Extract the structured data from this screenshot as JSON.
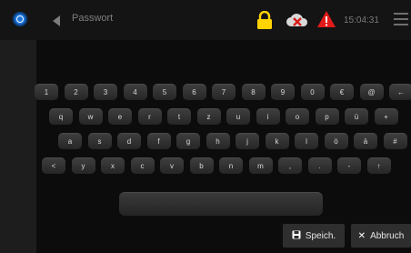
{
  "header": {
    "title": "Passwort",
    "time": "15:04:31",
    "lock_color": "#ffd400",
    "warning_color": "#e31a1a"
  },
  "keyboard": {
    "row1": [
      "1",
      "2",
      "3",
      "4",
      "5",
      "6",
      "7",
      "8",
      "9",
      "0",
      "€",
      "@",
      "←"
    ],
    "row2": [
      "q",
      "w",
      "e",
      "r",
      "t",
      "z",
      "u",
      "i",
      "o",
      "p",
      "ü",
      "+"
    ],
    "row3": [
      "a",
      "s",
      "d",
      "f",
      "g",
      "h",
      "j",
      "k",
      "l",
      "ö",
      "ä",
      "#"
    ],
    "row4": [
      "<",
      "y",
      "x",
      "c",
      "v",
      "b",
      "n",
      "m",
      ",",
      ".",
      "-",
      "↑"
    ]
  },
  "actions": {
    "save_label": "Speich.",
    "save_icon": "save-icon",
    "cancel_label": "Abbruch",
    "cancel_icon": "close-icon"
  }
}
